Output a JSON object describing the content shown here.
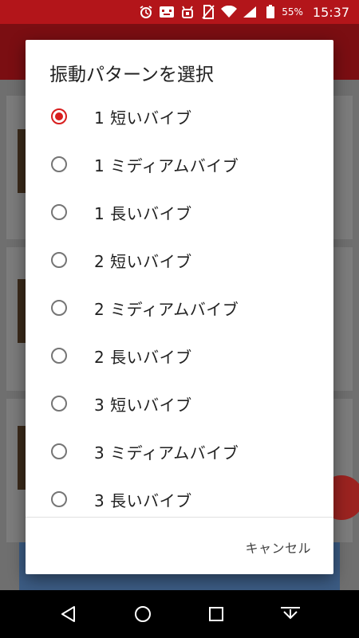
{
  "status_bar": {
    "battery": "55%",
    "time": "15:37"
  },
  "dialog": {
    "title": "振動パターンを選択",
    "options": [
      {
        "label": "1 短いバイブ",
        "checked": true
      },
      {
        "label": "1 ミディアムバイブ",
        "checked": false
      },
      {
        "label": "1 長いバイブ",
        "checked": false
      },
      {
        "label": "2 短いバイブ",
        "checked": false
      },
      {
        "label": "2 ミディアムバイブ",
        "checked": false
      },
      {
        "label": "2 長いバイブ",
        "checked": false
      },
      {
        "label": "3 短いバイブ",
        "checked": false
      },
      {
        "label": "3 ミディアムバイブ",
        "checked": false
      },
      {
        "label": "3 長いバイブ",
        "checked": false
      }
    ],
    "cancel_label": "キャンセル"
  },
  "colors": {
    "accent": "#d81e1e",
    "status_bar": "#b3151a"
  }
}
